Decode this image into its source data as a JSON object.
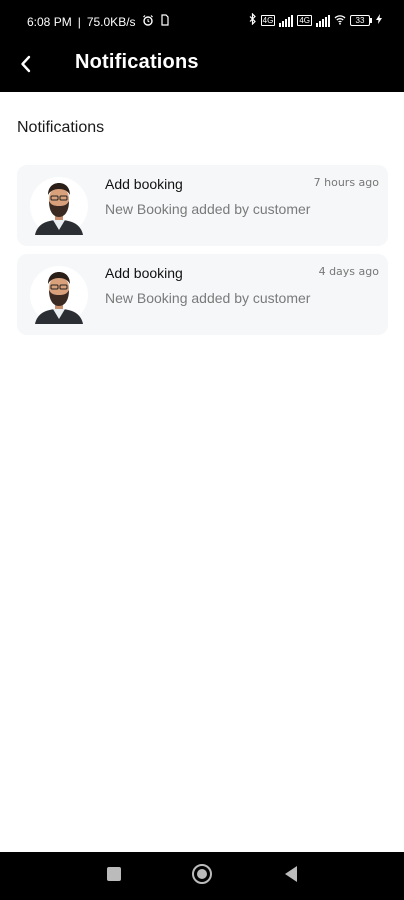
{
  "status_bar": {
    "time": "6:08 PM",
    "network_speed": "75.0KB/s",
    "battery": "33"
  },
  "app_bar": {
    "title": "Notifications"
  },
  "page": {
    "section_title": "Notifications"
  },
  "notifications": [
    {
      "title": "Add booking",
      "time": "7 hours ago",
      "message": "New Booking added by customer"
    },
    {
      "title": "Add booking",
      "time": "4 days ago",
      "message": "New Booking added by customer"
    }
  ],
  "colors": {
    "bar_background": "#000000",
    "card_background": "#f5f7f9"
  },
  "icons": {
    "back": "chevron-left-icon",
    "nav_recents": "square-icon",
    "nav_home": "circle-icon",
    "nav_back": "triangle-back-icon"
  }
}
